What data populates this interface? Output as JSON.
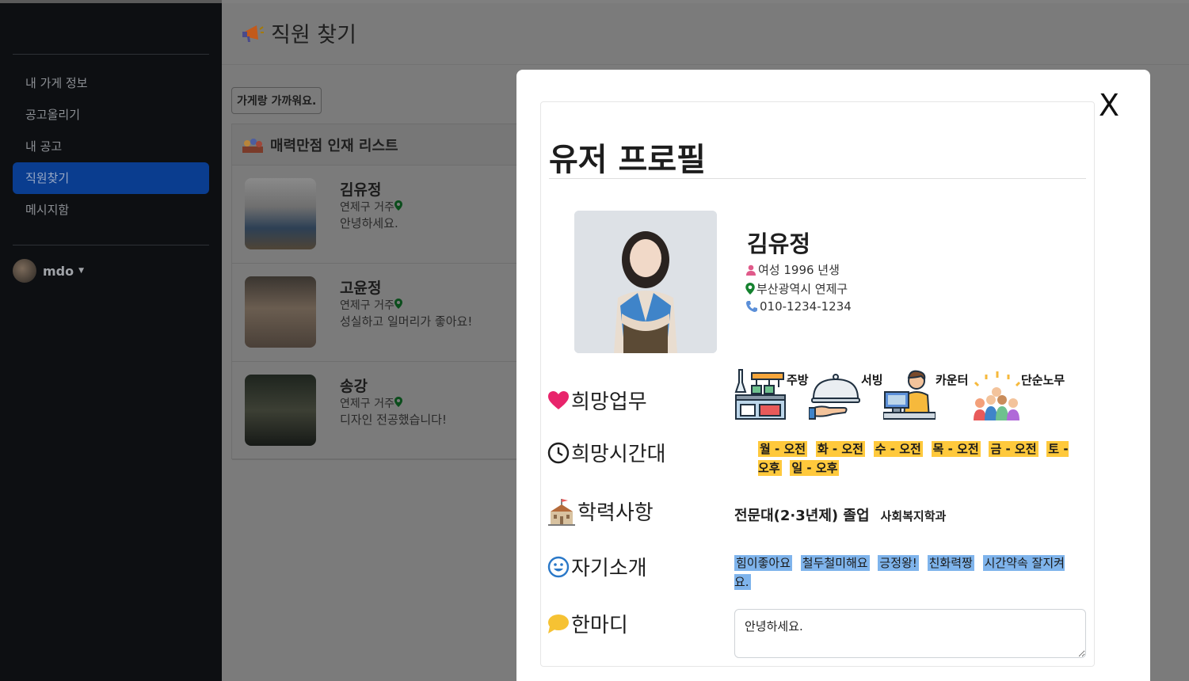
{
  "sidebar": {
    "items": [
      {
        "label": "내 가게 정보"
      },
      {
        "label": "공고올리기"
      },
      {
        "label": "내 공고"
      },
      {
        "label": "직원찾기"
      },
      {
        "label": "메시지함"
      }
    ],
    "active_index": 3,
    "user": {
      "name": "mdo"
    }
  },
  "page": {
    "title": "직원 찾기",
    "filter_button": "가게랑 가까워요.",
    "list_title": "매력만점 인재 리스트"
  },
  "candidates": [
    {
      "name": "김유정",
      "location": "연제구 거주",
      "message": "안녕하세요."
    },
    {
      "name": "고윤정",
      "location": "연제구 거주",
      "message": "성실하고 일머리가 좋아요!"
    },
    {
      "name": "송강",
      "location": "연제구 거주",
      "message": "디자인 전공했습니다!"
    }
  ],
  "modal": {
    "close_label": "X",
    "title": "유저 프로필",
    "profile": {
      "name": "김유정",
      "gender_birth": "여성 1996 년생",
      "address": "부산광역시 연제구",
      "phone": "010-1234-1234"
    },
    "sections": {
      "jobs_label": "희망업무",
      "time_label": "희망시간대",
      "edu_label": "학력사항",
      "intro_label": "자기소개",
      "comment_label": "한마디"
    },
    "jobs": [
      "주방",
      "서빙",
      "카운터",
      "단순노무"
    ],
    "times": [
      "월 - 오전",
      "화 - 오전",
      "수 - 오전",
      "목 - 오전",
      "금 - 오전",
      "토 - 오후",
      "일 - 오후"
    ],
    "education": {
      "degree": "전문대(2·3년제) 졸업",
      "major": "사회복지학과"
    },
    "intro_tags": [
      "힘이좋아요",
      "철두철미해요",
      "긍정왕!",
      "친화력짱",
      "시간약속 잘지켜요."
    ],
    "comment": "안녕하세요."
  },
  "colors": {
    "sidebar_bg": "#0d0f12",
    "active_nav": "#0a3d8f",
    "time_chip": "#ffc93c",
    "intro_chip": "#7fb4ec",
    "heart": "#e8246b"
  }
}
